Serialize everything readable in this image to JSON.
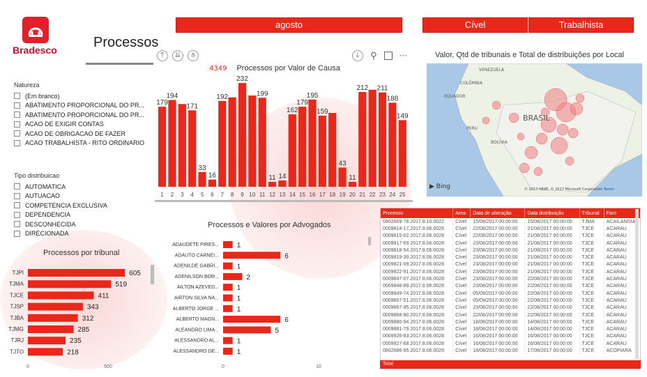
{
  "header": {
    "brand": "Bradesco",
    "page_title": "Processos",
    "filters": [
      {
        "label": "agosto"
      },
      {
        "label": "Cível"
      },
      {
        "label": "Trabalhista"
      }
    ]
  },
  "natureza": {
    "title": "Natureza",
    "items": [
      "(Em branco)",
      "ABATIMENTO PROPORCIONAL DO PR...",
      "ABATIMENTO PROPORCIONAL DO PR...",
      "ACAO DE EXIGIR CONTAS",
      "ACAO DE OBRIGACAO DE FAZER",
      "ACAO TRABALHISTA - RITO ORDINARIO"
    ]
  },
  "tipo": {
    "title": "Tipo distribuicao",
    "items": [
      "AUTOMATICA",
      "AUTUACAO",
      "COMPETENCIA EXCLUSIVA",
      "DEPENDENCIA",
      "DESCONHECIDA",
      "DIRECIONADA"
    ]
  },
  "valor_chart": {
    "title": "Processos por Valor de Causa",
    "total": "4349"
  },
  "tribunal_chart": {
    "title": "Processos por tribunal"
  },
  "advogados_chart": {
    "title": "Processos e Valores por Advogados"
  },
  "map": {
    "title": "Valor, Qtd de tribunais e Total de distribuições por Local",
    "labels": {
      "brasil": "BRASIL",
      "venezuela": "VENEZUELA",
      "colombia": "COLÔMBIA",
      "equador": "EQUADOR",
      "peru": "PERU",
      "bolivia": "BOLÍVIA"
    },
    "bing": "Bing",
    "copyright": "© 2017 HERE, © 2017 Microsoft Corporation",
    "terms": "Terms"
  },
  "table": {
    "columns": [
      "Processo",
      "Area",
      "Data de alteração",
      "Data distribuição",
      "Tribunal",
      "Foro"
    ],
    "rows": [
      [
        "0802669-78.2017.8.10.0022",
        "Cível",
        "15/08/2017 00:00:00",
        "15/08/2017 00:00:00",
        "TJMA",
        "ACAILANDIA"
      ],
      [
        "0009814-17.2017.8.06.0028",
        "Cível",
        "22/08/2017 00:00:00",
        "21/08/2017 00:00:00",
        "TJCE",
        "ACARAU"
      ],
      [
        "0009815-02.2017.8.06.0028",
        "Cível",
        "22/08/2017 00:00:00",
        "21/08/2017 00:00:00",
        "TJCE",
        "ACARAU"
      ],
      [
        "0009817-69.2017.8.06.0028",
        "Cível",
        "23/08/2017 00:00:00",
        "21/08/2017 00:00:00",
        "TJCE",
        "ACARAU"
      ],
      [
        "0009818-54.2017.8.06.0028",
        "Cível",
        "23/08/2017 00:00:00",
        "21/08/2017 00:00:00",
        "TJCE",
        "ACARAU"
      ],
      [
        "0009819-39.2017.8.06.0028",
        "Cível",
        "23/08/2017 00:00:00",
        "21/08/2017 00:00:00",
        "TJCE",
        "ACARAU"
      ],
      [
        "0009821-09.2017.8.06.0028",
        "Cível",
        "23/08/2017 00:00:00",
        "21/08/2017 00:00:00",
        "TJCE",
        "ACARAU"
      ],
      [
        "0009822-91.2017.8.06.0028",
        "Cível",
        "23/08/2017 00:00:00",
        "21/08/2017 00:00:00",
        "TJCE",
        "ACARAU"
      ],
      [
        "0009847-07.2017.8.06.0028",
        "Cível",
        "23/08/2017 00:00:00",
        "22/08/2017 00:00:00",
        "TJCE",
        "ACARAU"
      ],
      [
        "0009848-89.2017.8.06.0028",
        "Cível",
        "23/08/2017 00:00:00",
        "22/08/2017 00:00:00",
        "TJCE",
        "ACARAU"
      ],
      [
        "0009849-74.2017.8.06.0028",
        "Cível",
        "05/09/2017 00:00:00",
        "22/08/2017 00:00:00",
        "TJCE",
        "ACARAU"
      ],
      [
        "0009857-51.2017.8.06.0028",
        "Cível",
        "05/09/2017 00:00:00",
        "22/08/2017 00:00:00",
        "TJCE",
        "ACARAU"
      ],
      [
        "0009867-95.2017.8.06.0028",
        "Cível",
        "23/08/2017 00:00:00",
        "22/08/2017 00:00:00",
        "TJCE",
        "ACARAU"
      ],
      [
        "0009868-80.2017.8.06.0028",
        "Cível",
        "22/08/2017 00:00:00",
        "22/08/2017 00:00:00",
        "TJCE",
        "ACARAU"
      ],
      [
        "0009880-94.2017.8.06.0028",
        "Cível",
        "18/08/2017 00:00:00",
        "14/08/2017 00:00:00",
        "TJCE",
        "ACARAU"
      ],
      [
        "0009881-79.2017.8.06.0028",
        "Cível",
        "18/08/2017 00:00:00",
        "14/08/2017 00:00:00",
        "TJCE",
        "ACARAU"
      ],
      [
        "0009926-83.2017.8.06.0028",
        "Cível",
        "16/08/2017 00:00:00",
        "16/08/2017 00:00:00",
        "TJCE",
        "ACARAU"
      ],
      [
        "0009927-68.2017.8.06.0028",
        "Cível",
        "16/08/2017 00:00:00",
        "16/08/2017 00:00:00",
        "TJCE",
        "ACARAU"
      ],
      [
        "0802686-95.2017.8.06.0029",
        "Cível",
        "18/08/2017 00:00:00",
        "17/08/2017 00:00:00",
        "TJCE",
        "ACOPIARA"
      ]
    ],
    "total_label": "Total"
  },
  "chart_data": [
    {
      "type": "bar",
      "title": "Processos por Valor de Causa",
      "categories": [
        "1",
        "2",
        "3",
        "4",
        "5",
        "6",
        "7",
        "8",
        "9",
        "10",
        "11",
        "12",
        "13",
        "14",
        "15",
        "16",
        "17",
        "18",
        "19",
        "20",
        "21",
        "22",
        "23",
        "24",
        "25"
      ],
      "values": [
        179,
        194,
        185,
        171,
        33,
        16,
        192,
        200,
        232,
        204,
        199,
        11,
        14,
        162,
        179,
        195,
        159,
        165,
        43,
        11,
        212,
        217,
        211,
        188,
        149
      ],
      "labels": [
        "179",
        "194",
        "",
        "171",
        "33",
        "16",
        "192",
        "",
        "232",
        "",
        "199",
        "11",
        "14",
        "162",
        "179",
        "195",
        "159",
        "",
        "43",
        "11",
        "212",
        "",
        "211",
        "188",
        "149"
      ],
      "ylim": [
        0,
        240
      ]
    },
    {
      "type": "bar",
      "title": "Processos por tribunal",
      "categories": [
        "TJPI",
        "TJMA",
        "TJCE",
        "TJSP",
        "TJBA",
        "TJMG",
        "TJRJ",
        "TJTO"
      ],
      "values": [
        605,
        519,
        411,
        343,
        312,
        285,
        235,
        218
      ],
      "xticks": [
        "0",
        "500"
      ],
      "xlim": [
        0,
        700
      ]
    },
    {
      "type": "bar",
      "title": "Processos e Valores por Advogados",
      "categories": [
        "ADAUDETE PIRES...",
        "ADAUTO CARNEI...",
        "ADENILDE GABRI...",
        "ADENILSON BOR...",
        "AILTON AZEVED...",
        "AIRTON SILVA NA...",
        "ALBERTO JORGE ...",
        "ALBERTO MAGN...",
        "ALEANDRO LIMA...",
        "ALESSANDRO AL...",
        "ALESSANDRO DE..."
      ],
      "values": [
        1,
        6,
        1,
        2,
        1,
        1,
        1,
        6,
        5,
        1,
        1
      ],
      "xticks": [
        "0",
        "10"
      ],
      "xlim": [
        0,
        10
      ]
    }
  ],
  "colors": {
    "accent": "#e8281a",
    "map_water": "#a9c8e8",
    "bubble": "#f08080"
  }
}
